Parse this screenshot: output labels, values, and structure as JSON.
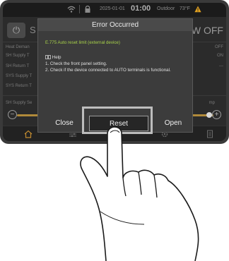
{
  "status_bar": {
    "date": "2025-01-01",
    "time": "01:00",
    "outdoor_label": "Outdoor",
    "outdoor_temp": "73°F",
    "icons": [
      "wifi-icon",
      "lock-icon",
      "warning-icon"
    ],
    "warning_color": "#e0a020"
  },
  "background": {
    "power_icon": "⏻",
    "mode_partial": "S",
    "mode_status_partial": "W OFF",
    "rows": [
      {
        "label": "Heat Deman",
        "value": "OFF"
      },
      {
        "label": "SH Supply T",
        "value": "ON"
      },
      {
        "label": "SH Return T",
        "value": "---"
      },
      {
        "label": "SYS Supply T",
        "value": ""
      },
      {
        "label": "SYS Return T",
        "value": ""
      },
      {
        "label": "SH Supply Se",
        "value": ""
      }
    ],
    "temp_label_partial": "mp",
    "minus_label": "−",
    "plus_label": "+",
    "slider_fraction": 0.92,
    "accent_color": "#b08a3a",
    "nav_icons": [
      "home-icon",
      "sliders-icon",
      "gear-icon",
      "document-icon"
    ],
    "nav_active_color": "#c08a30"
  },
  "dialog": {
    "title": "Error Occurred",
    "error_message": "E.775 Auto reset limit (external device)",
    "error_color": "#a9d34a",
    "help_heading": "Help",
    "help_icon": "book-icon",
    "help_lines": [
      "1. Check the front panel setting.",
      "2. Check if the device connected to AUTO terminals is functional."
    ],
    "buttons": {
      "close": "Close",
      "reset": "Reset",
      "open": "Open"
    }
  },
  "annotation": {
    "pointer": "hand-pointer-icon",
    "highlighted_button": "Reset"
  }
}
